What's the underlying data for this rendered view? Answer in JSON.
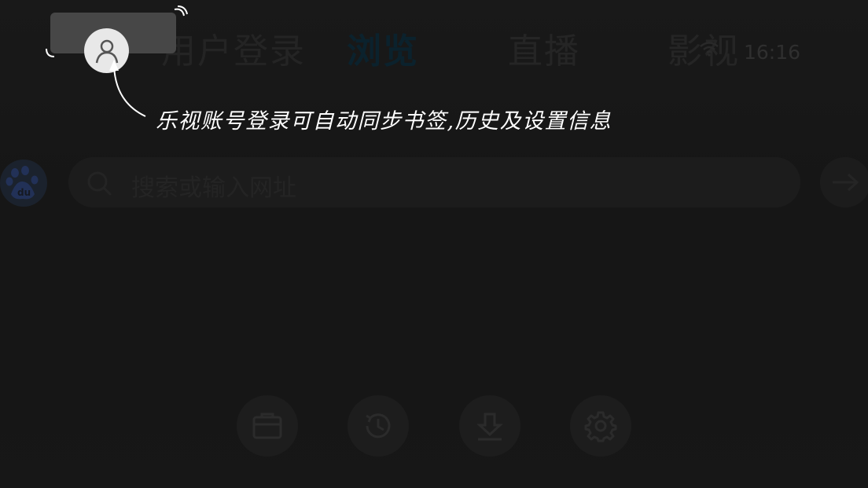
{
  "nav": {
    "login_tab": "用户登录",
    "browse_tab": "浏览",
    "live_tab": "直播",
    "video_tab": "影视"
  },
  "status": {
    "time": "16:16",
    "wifi_icon": "wifi-icon"
  },
  "guide": {
    "hint": "乐视账号登录可自动同步书签,历史及设置信息"
  },
  "search": {
    "engine_icon": "baidu-icon",
    "placeholder": "搜索或输入网址",
    "go_icon": "arrow-right-icon"
  },
  "toolbar": {
    "items": [
      {
        "icon": "folder-icon"
      },
      {
        "icon": "history-icon"
      },
      {
        "icon": "download-icon"
      },
      {
        "icon": "settings-icon"
      }
    ]
  },
  "colors": {
    "background": "#1b1b1b",
    "highlight_frame": "#474747",
    "active_tab": "#0e2a38",
    "hint_text": "#ffffff"
  }
}
